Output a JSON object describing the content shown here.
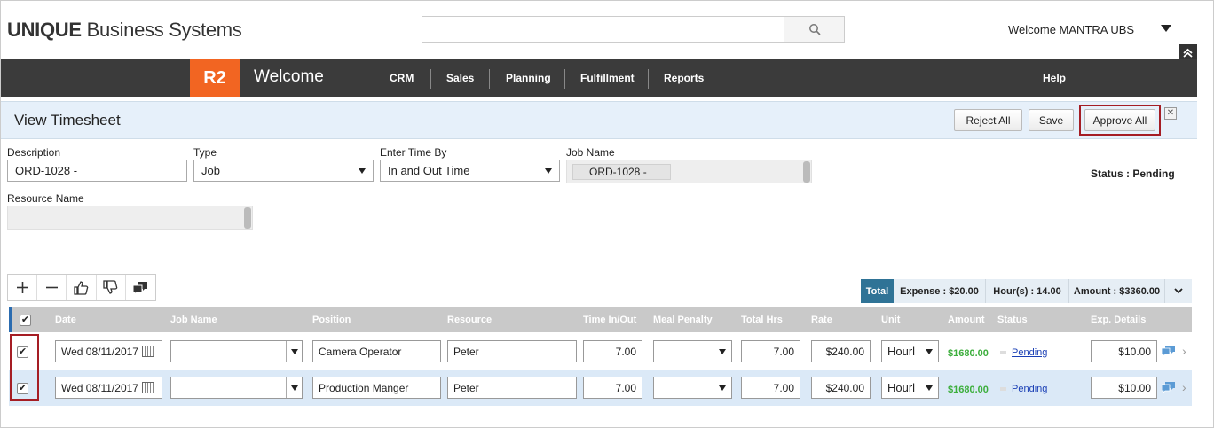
{
  "header": {
    "logo_bold": "UNIQUE",
    "logo_rest": " Business Systems",
    "search_placeholder": "",
    "welcome_user": "Welcome MANTRA UBS"
  },
  "nav": {
    "badge": "R2",
    "title": "Welcome",
    "items": [
      "CRM",
      "Sales",
      "Planning",
      "Fulfillment",
      "Reports"
    ],
    "help": "Help"
  },
  "page": {
    "title": "View Timesheet",
    "buttons": {
      "reject_all": "Reject All",
      "save": "Save",
      "approve_all": "Approve All"
    }
  },
  "form": {
    "description": {
      "label": "Description",
      "value": "ORD-1028 -"
    },
    "type": {
      "label": "Type",
      "value": "Job"
    },
    "enter_time_by": {
      "label": "Enter Time By",
      "value": "In and Out Time"
    },
    "job_name": {
      "label": "Job Name",
      "value": "ORD-1028 -"
    },
    "resource_name": {
      "label": "Resource Name",
      "value": ""
    },
    "status": "Status : Pending"
  },
  "summary": {
    "total_label": "Total",
    "expense": "Expense : $20.00",
    "hours": "Hour(s) : 14.00",
    "amount": "Amount : $3360.00"
  },
  "grid": {
    "columns": [
      "Date",
      "Job Name",
      "Position",
      "Resource",
      "Time In/Out",
      "Meal Penalty",
      "Total Hrs",
      "Rate",
      "Unit",
      "Amount",
      "Status",
      "Exp. Details"
    ],
    "rows": [
      {
        "checked": true,
        "date": "Wed 08/11/2017",
        "job_name": "",
        "position": "Camera Operator",
        "resource": "Peter",
        "time_in_out": "7.00",
        "meal_penalty": "",
        "total_hrs": "7.00",
        "rate": "$240.00",
        "unit": "Hourl",
        "amount": "$1680.00",
        "status": "Pending",
        "exp_details": "$10.00"
      },
      {
        "checked": true,
        "date": "Wed 08/11/2017",
        "job_name": "",
        "position": "Production Manger",
        "resource": "Peter",
        "time_in_out": "7.00",
        "meal_penalty": "",
        "total_hrs": "7.00",
        "rate": "$240.00",
        "unit": "Hourl",
        "amount": "$1680.00",
        "status": "Pending",
        "exp_details": "$10.00"
      }
    ]
  },
  "colors": {
    "nav_bg": "#3b3b3b",
    "badge": "#f26522",
    "subheader_bg": "#e6f0fa",
    "highlight_outline": "#a51d24",
    "total_bg": "#2f7396",
    "amount_green": "#3cae3c",
    "row_selected": "#dbe9f7"
  }
}
